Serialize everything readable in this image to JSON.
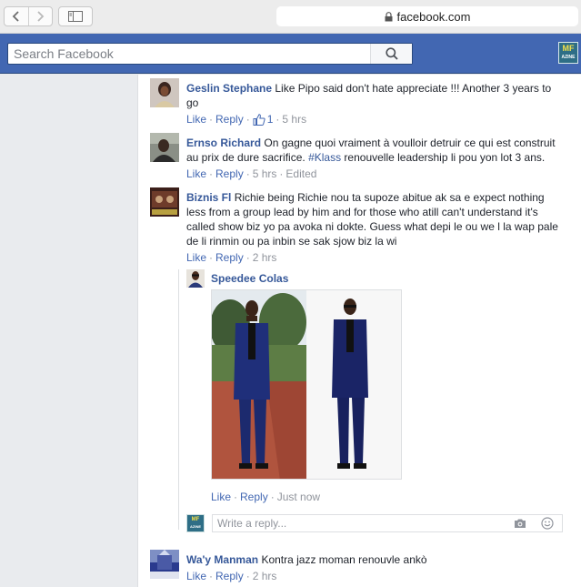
{
  "browser": {
    "url": "facebook.com"
  },
  "header": {
    "search_placeholder": "Search Facebook",
    "logo_line1": "MF",
    "logo_line2": "AZINE"
  },
  "comments": [
    {
      "author": "Geslin Stephane",
      "text": "Like Pipo said don't hate appreciate !!! Another 3 years to go",
      "like": "Like",
      "reply": "Reply",
      "likes": "1",
      "time": "5 hrs"
    },
    {
      "author": "Ernso Richard",
      "text_before": "On gagne quoi vraiment à voulloir detruir ce qui est construit au prix de dure sacrifice. ",
      "hashtag": "#Klass",
      "text_after": " renouvelle leadership li pou yon lot 3 ans.",
      "like": "Like",
      "reply": "Reply",
      "time": "5 hrs",
      "edited": "Edited"
    },
    {
      "author": "Biznis Fl",
      "text": "Richie being Richie nou ta supoze abitue ak sa e expect nothing less from a group lead by him and for those who atill can't understand it's called show biz yo pa avoka ni dokte. Guess what depi le ou we l la wap pale de li rinmin ou pa inbin se sak sjow biz la wi",
      "like": "Like",
      "reply": "Reply",
      "time": "2 hrs",
      "replies": [
        {
          "author": "Speedee Colas",
          "like": "Like",
          "reply": "Reply",
          "time": "Just now"
        }
      ],
      "reply_placeholder": "Write a reply..."
    },
    {
      "author": "Wa'y Manman",
      "text": "Kontra jazz moman renouvle ankò",
      "like": "Like",
      "reply": "Reply",
      "time": "2 hrs"
    }
  ]
}
